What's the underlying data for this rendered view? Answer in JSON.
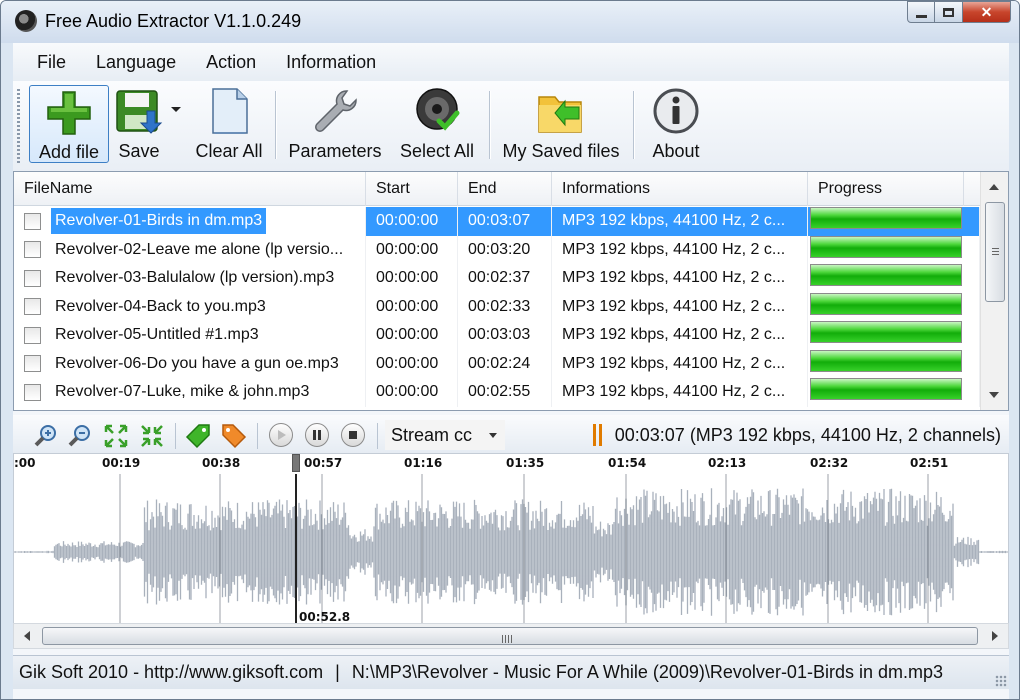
{
  "window": {
    "title": "Free Audio Extractor V1.1.0.249"
  },
  "menu": [
    "File",
    "Language",
    "Action",
    "Information"
  ],
  "toolbar": {
    "add_file": "Add file",
    "save": "Save",
    "clear_all": "Clear All",
    "parameters": "Parameters",
    "select_all": "Select All",
    "my_saved_files": "My Saved files",
    "about": "About"
  },
  "list": {
    "columns": [
      "FileName",
      "Start",
      "End",
      "Informations",
      "Progress"
    ],
    "rows": [
      {
        "name": "Revolver-01-Birds in dm.mp3",
        "start": "00:00:00",
        "end": "00:03:07",
        "info": "MP3 192 kbps, 44100 Hz, 2 c...",
        "progress": 1.0,
        "selected": true
      },
      {
        "name": "Revolver-02-Leave me alone (lp versio...",
        "start": "00:00:00",
        "end": "00:03:20",
        "info": "MP3 192 kbps, 44100 Hz, 2 c...",
        "progress": 1.0,
        "selected": false
      },
      {
        "name": "Revolver-03-Balulalow (lp version).mp3",
        "start": "00:00:00",
        "end": "00:02:37",
        "info": "MP3 192 kbps, 44100 Hz, 2 c...",
        "progress": 1.0,
        "selected": false
      },
      {
        "name": "Revolver-04-Back to you.mp3",
        "start": "00:00:00",
        "end": "00:02:33",
        "info": "MP3 192 kbps, 44100 Hz, 2 c...",
        "progress": 1.0,
        "selected": false
      },
      {
        "name": "Revolver-05-Untitled #1.mp3",
        "start": "00:00:00",
        "end": "00:03:03",
        "info": "MP3 192 kbps, 44100 Hz, 2 c...",
        "progress": 1.0,
        "selected": false
      },
      {
        "name": "Revolver-06-Do you have a gun oe.mp3",
        "start": "00:00:00",
        "end": "00:02:24",
        "info": "MP3 192 kbps, 44100 Hz, 2 c...",
        "progress": 1.0,
        "selected": false
      },
      {
        "name": "Revolver-07-Luke, mike & john.mp3",
        "start": "00:00:00",
        "end": "00:02:55",
        "info": "MP3 192 kbps, 44100 Hz, 2 c...",
        "progress": 1.0,
        "selected": false
      }
    ]
  },
  "player": {
    "stream_label": "Stream cc",
    "track_info": "00:03:07 (MP3 192 kbps, 44100 Hz, 2 channels)"
  },
  "waveform": {
    "tick_labels": [
      ":00",
      "00:19",
      "00:38",
      "00:57",
      "01:16",
      "01:35",
      "01:54",
      "02:13",
      "02:32",
      "02:51"
    ],
    "cursor_time": "00:52.8"
  },
  "status": {
    "left": "Gik Soft 2010 - http://www.giksoft.com",
    "separator": "|",
    "right": "N:\\MP3\\Revolver - Music For A While (2009)\\Revolver-01-Birds in dm.mp3"
  },
  "colors": {
    "selection": "#3399ff",
    "progress_green": "#12ad0a",
    "waveform": "#a9b1bc",
    "accent_orange": "#e07b00"
  }
}
